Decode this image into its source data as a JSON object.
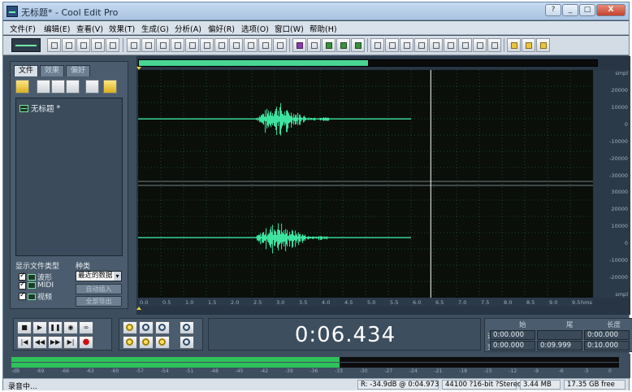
{
  "window": {
    "title": "无标题* - Cool Edit Pro",
    "controls": [
      "?",
      "_",
      "□",
      "X"
    ]
  },
  "menu": [
    "文件(F)",
    "编辑(E)",
    "查看(V)",
    "效果(T)",
    "生成(G)",
    "分析(A)",
    "偏好(R)",
    "选项(O)",
    "窗口(W)",
    "帮助(H)"
  ],
  "left_panel": {
    "tabs": [
      "文件",
      "效果",
      "偏好"
    ],
    "files": [
      {
        "name": "无标题",
        "suffix": "*"
      }
    ],
    "file_type_label": "显示文件类型",
    "sort_label": "种类",
    "file_types": [
      "波形",
      "MIDI",
      "视频"
    ],
    "sort_value": "最近的数据",
    "buttons": [
      "自动插入",
      "全部导出"
    ]
  },
  "waveform": {
    "overview_fraction": 0.5,
    "cursor_seconds": 6.434,
    "channels": 2,
    "amp_ticks": [
      "smpl",
      "20000",
      "10000",
      "0",
      "-10000",
      "-20000",
      "-30000",
      "30000",
      "20000",
      "10000",
      "0",
      "-10000",
      "-20000",
      "smpl"
    ],
    "time_axis_label": "hms",
    "time_ticks": [
      "0.0",
      "0.5",
      "1.0",
      "1.5",
      "2.0",
      "2.5",
      "3.0",
      "3.5",
      "4.0",
      "4.5",
      "5.0",
      "5.5",
      "6.0",
      "6.5",
      "7.0",
      "7.5",
      "8.0",
      "8.5",
      "9.0",
      "9.5",
      "hms"
    ],
    "bursts": [
      {
        "start": 2.6,
        "end": 4.2
      }
    ],
    "signal_end_seconds": 6.0
  },
  "time_display": "0:06.434",
  "selection": {
    "headers": [
      "始",
      "尾",
      "长度"
    ],
    "rows": [
      {
        "label": "选",
        "values": [
          "0:00.000",
          "",
          "0:00.000"
        ]
      },
      {
        "label": "查看",
        "values": [
          "0:00.000",
          "0:09.999",
          "0:10.000"
        ]
      }
    ]
  },
  "levels": {
    "level_fraction": 0.54,
    "ticks": [
      "-dB",
      "-69",
      "-66",
      "-63",
      "-60",
      "-57",
      "-54",
      "-51",
      "-48",
      "-45",
      "-42",
      "-39",
      "-36",
      "-33",
      "-30",
      "-27",
      "-24",
      "-21",
      "-18",
      "-15",
      "-12",
      "-9",
      "-6",
      "-3",
      "0"
    ]
  },
  "status": {
    "left": "录音中...",
    "cells": [
      "R: -34.9dB @  0:04.973",
      "44100 ?16-bit ?Stereo",
      "3.44 MB",
      "17.35 GB free"
    ]
  },
  "colors": {
    "waveform": "#3fe3a0",
    "background": "#0a0f0a",
    "grid": "#1f4a2c",
    "cursor": "#ffffff"
  }
}
